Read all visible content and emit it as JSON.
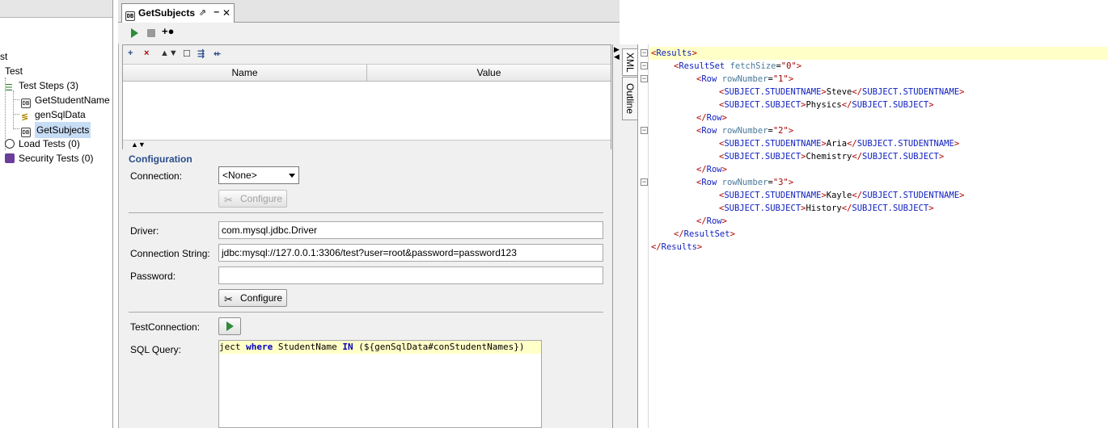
{
  "tree": {
    "items": [
      {
        "label": "st"
      },
      {
        "label": "Test"
      },
      {
        "label": "Test Steps (3)"
      },
      {
        "label": "GetStudentName"
      },
      {
        "label": "genSqlData"
      },
      {
        "label": "GetSubjects"
      },
      {
        "label": "Load Tests (0)"
      },
      {
        "label": "Security Tests (0)"
      }
    ]
  },
  "editor": {
    "tab_title": "GetSubjects",
    "tab_pin": "⇗",
    "tab_min": "–",
    "tab_close": "✕",
    "props": {
      "col_name": "Name",
      "col_value": "Value",
      "toolbar": [
        "+",
        "×",
        "▲▼",
        "☐",
        "⇶",
        "⇷"
      ]
    },
    "config": {
      "title": "Configuration",
      "connection_label": "Connection:",
      "connection_value": "<None>",
      "configure_label": "Configure",
      "driver_label": "Driver:",
      "driver_value": "com.mysql.jdbc.Driver",
      "conn_string_label": "Connection String:",
      "conn_string_value": "jdbc:mysql://127.0.0.1:3306/test?user=root&password=password123",
      "password_label": "Password:",
      "password_value": "",
      "configure2_label": "Configure",
      "test_connection_label": "TestConnection:",
      "sql_label": "SQL Query:",
      "sql_parts": {
        "a": "ject ",
        "kw1": "where",
        "b": " StudentName ",
        "kw2": "IN",
        "c": " (${genSqlData#conStudentNames})"
      }
    }
  },
  "side_tabs": {
    "xml": "XML",
    "outline": "Outline"
  },
  "xml": {
    "results_open": "Results",
    "resultset_open": "ResultSet",
    "attr_fetch": "fetchSize",
    "fetch_val": "\"0\"",
    "row": "Row",
    "attr_rownum": "rowNumber",
    "col_student": "SUBJECT.STUDENTNAME",
    "col_subject": "SUBJECT.SUBJECT",
    "rows": [
      {
        "num": "\"1\"",
        "student": "Steve",
        "subject": "Physics"
      },
      {
        "num": "\"2\"",
        "student": "Aria",
        "subject": "Chemistry"
      },
      {
        "num": "\"3\"",
        "student": "Kayle",
        "subject": "History"
      }
    ],
    "results_close": "Results",
    "resultset_close": "ResultSet"
  }
}
